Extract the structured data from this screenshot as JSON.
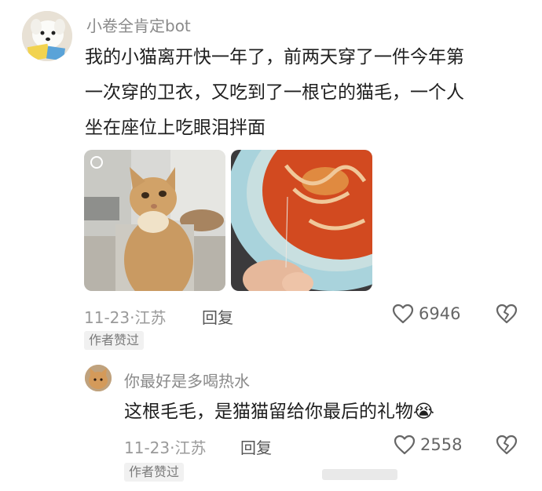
{
  "colors": {
    "text": "#1f1f1f",
    "muted": "#9a9a9a",
    "username": "#8a8a8a",
    "badge_bg": "#f1f1f1"
  },
  "comment": {
    "username": "小卷全肯定bot",
    "text_lines": [
      "我的小猫离开快一年了，前两天穿了一件今年第",
      "一次穿的卫衣，又吃到了一根它的猫毛，一个人",
      "坐在座位上吃眼泪拌面"
    ],
    "date": "11-23",
    "separator": "·",
    "location": "江苏",
    "reply_label": "回复",
    "like_count": "6946",
    "badge": "作者赞过",
    "images": [
      {
        "icon": "cat-photo"
      },
      {
        "icon": "noodle-bowl-photo"
      }
    ]
  },
  "reply": {
    "username": "你最好是多喝热水",
    "text": "这根毛毛，是猫猫留给你最后的礼物",
    "emoji": "😭",
    "date": "11-23",
    "separator": "·",
    "location": "江苏",
    "reply_label": "回复",
    "like_count": "2558",
    "badge": "作者赞过"
  },
  "icons": {
    "like": "heart-outline-icon",
    "dislike": "broken-heart-icon"
  }
}
